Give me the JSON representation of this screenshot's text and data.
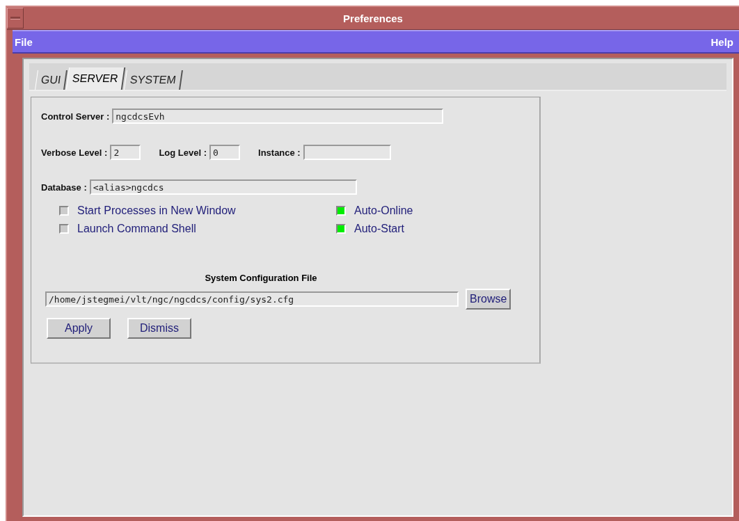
{
  "window": {
    "title": "Preferences"
  },
  "menu_bar": [
    {
      "label": "File"
    },
    {
      "label": "Help"
    }
  ],
  "tabs": [
    {
      "label": "GUI",
      "selected": false
    },
    {
      "label": "SERVER",
      "selected": true
    },
    {
      "label": "SYSTEM",
      "selected": false
    }
  ],
  "fields": {
    "control_server": {
      "label": "Control Server :",
      "value": "ngcdcsEvh"
    },
    "verbose_level": {
      "label": "Verbose Level :",
      "value": "2"
    },
    "log_level": {
      "label": "Log Level :",
      "value": "0"
    },
    "instance": {
      "label": "Instance :"
    },
    "database": {
      "label": "Database :",
      "value": "<alias>ngcdcs"
    }
  },
  "options": [
    {
      "label": "Start Processes in New Window",
      "checked": false
    },
    {
      "label": "Auto-Online",
      "checked": true
    },
    {
      "label": "Launch Command Shell",
      "checked": false
    },
    {
      "label": "Auto-Start",
      "checked": true
    }
  ],
  "config_file": {
    "heading": "System Configuration File",
    "value": "/home/jstegmei/vlt/ngc/ngcdcs/config/sys2.cfg",
    "browse_button": "Browse"
  },
  "buttons": [
    "Apply",
    "Dismiss"
  ]
}
